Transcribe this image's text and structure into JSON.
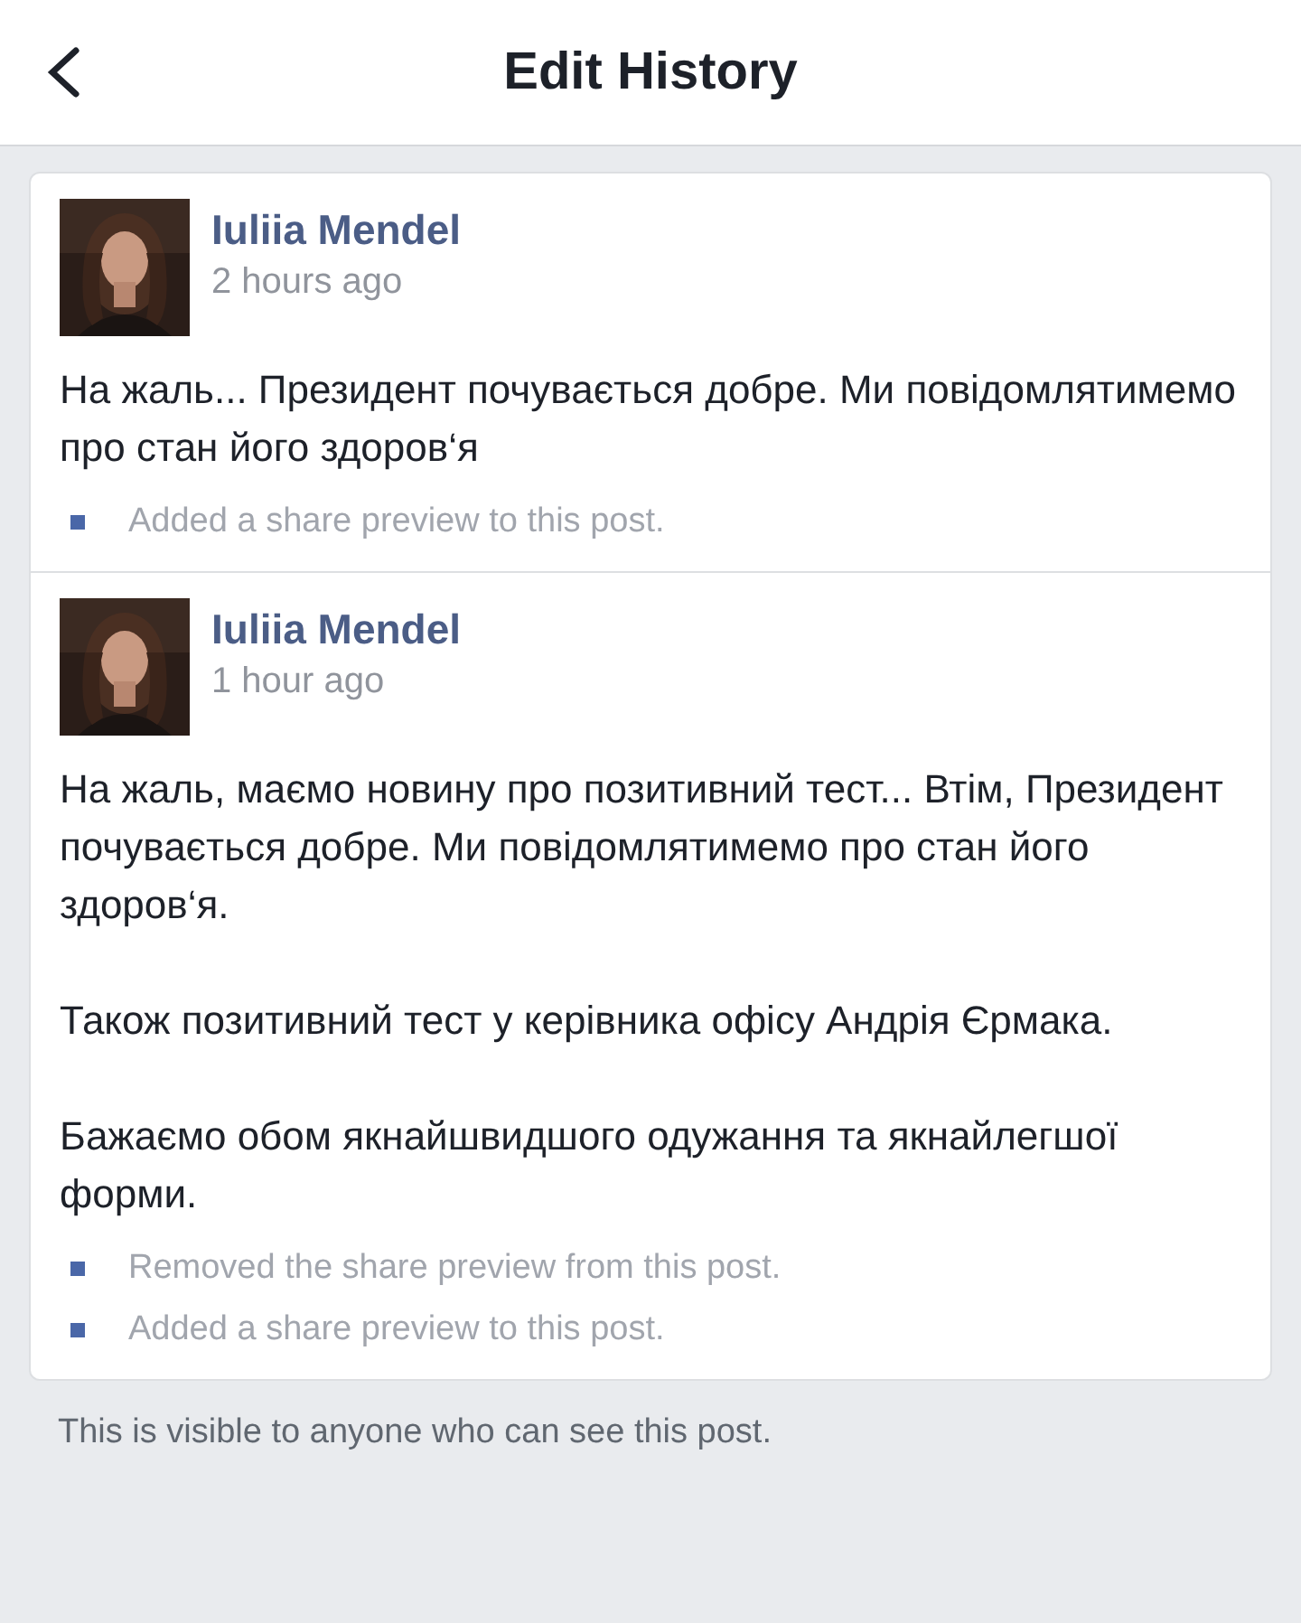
{
  "header": {
    "title": "Edit History"
  },
  "entries": [
    {
      "author": "Iuliia Mendel",
      "time": "2 hours ago",
      "avatar": {
        "kind": "picture"
      },
      "paragraphs": [
        "На жаль... Президент почувається добре. Ми повідомлятимемо про стан його здоров‘я"
      ],
      "changes": [
        "Added a share preview to this post."
      ]
    },
    {
      "author": "Iuliia Mendel",
      "time": "1 hour ago",
      "avatar": {
        "kind": "picture"
      },
      "paragraphs": [
        "На жаль, маємо новину про позитивний тест... Втім, Президент почувається добре. Ми повідомлятимемо про стан його здоров‘я.",
        "Також позитивний тест у керівника офісу Андрія Єрмака.",
        "Бажаємо обом якнайшвидшого одужання та якнайлегшої форми."
      ],
      "changes": [
        "Removed the share preview from this post.",
        "Added a share preview to this post."
      ]
    }
  ],
  "footer": "This is visible to anyone who can see this post."
}
